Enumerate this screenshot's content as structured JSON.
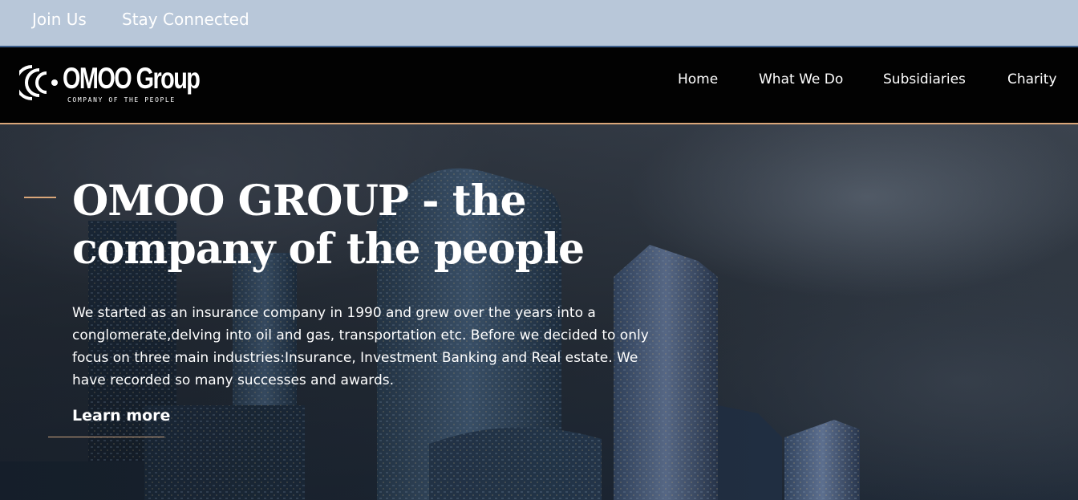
{
  "topbar": {
    "join_label": "Join Us",
    "stay_label": "Stay Connected"
  },
  "header": {
    "logo": {
      "wordmark": "OMOO Group",
      "tagline": "COMPANY OF THE PEOPLE"
    },
    "nav": {
      "home": "Home",
      "what_we_do": "What We Do",
      "subsidiaries": "Subsidiaries",
      "charity": "Charity"
    }
  },
  "hero": {
    "headline": "OMOO GROUP - the company of the people",
    "body": "We started as an insurance company in 1990 and grew over the years into a conglomerate,delving into oil and gas, transportation etc. Before we decided to only focus on three main industries:Insurance, Investment Banking and Real estate. We have recorded so many successes and awards.",
    "cta_label": "Learn more",
    "background": "city-skyline-image"
  },
  "colors": {
    "topbar_bg": "#b8c7d9",
    "navbar_bg": "#020202",
    "accent": "#d9a679",
    "text": "#ffffff"
  }
}
